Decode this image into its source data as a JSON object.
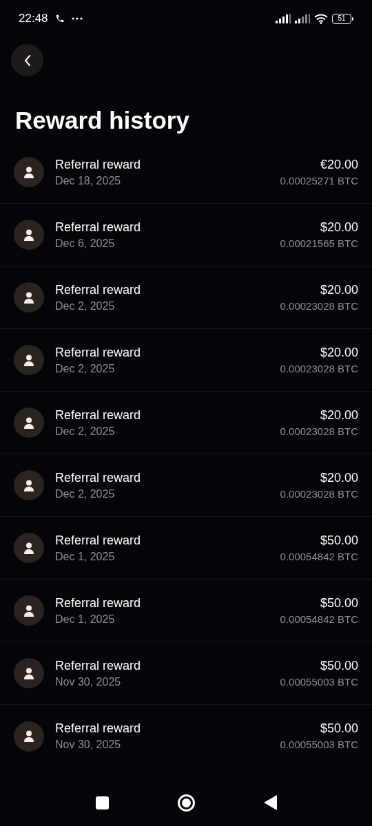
{
  "status_bar": {
    "time": "22:48",
    "battery": "51"
  },
  "title": "Reward history",
  "rewards": [
    {
      "label": "Referral reward",
      "date": "Dec 18, 2025",
      "amount": "€20.00",
      "btc": "0.00025271 BTC"
    },
    {
      "label": "Referral reward",
      "date": "Dec 6, 2025",
      "amount": "$20.00",
      "btc": "0.00021565 BTC"
    },
    {
      "label": "Referral reward",
      "date": "Dec 2, 2025",
      "amount": "$20.00",
      "btc": "0.00023028 BTC"
    },
    {
      "label": "Referral reward",
      "date": "Dec 2, 2025",
      "amount": "$20.00",
      "btc": "0.00023028 BTC"
    },
    {
      "label": "Referral reward",
      "date": "Dec 2, 2025",
      "amount": "$20.00",
      "btc": "0.00023028 BTC"
    },
    {
      "label": "Referral reward",
      "date": "Dec 2, 2025",
      "amount": "$20.00",
      "btc": "0.00023028 BTC"
    },
    {
      "label": "Referral reward",
      "date": "Dec 1, 2025",
      "amount": "$50.00",
      "btc": "0.00054842 BTC"
    },
    {
      "label": "Referral reward",
      "date": "Dec 1, 2025",
      "amount": "$50.00",
      "btc": "0.00054842 BTC"
    },
    {
      "label": "Referral reward",
      "date": "Nov 30, 2025",
      "amount": "$50.00",
      "btc": "0.00055003 BTC"
    },
    {
      "label": "Referral reward",
      "date": "Nov 30, 2025",
      "amount": "$50.00",
      "btc": "0.00055003 BTC"
    }
  ]
}
